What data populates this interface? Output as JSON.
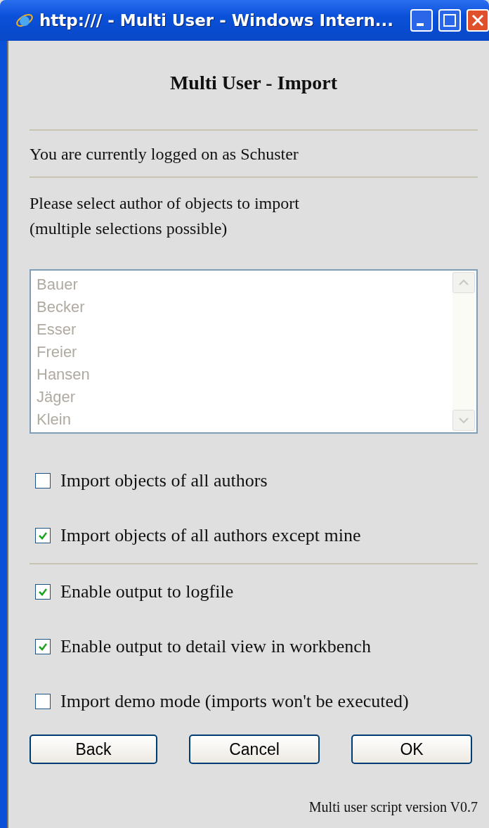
{
  "window": {
    "title": "http:/// - Multi User - Windows Intern..."
  },
  "heading": "Multi User - Import",
  "login_text": "You are currently logged on as Schuster",
  "instruction": [
    "Please select author of objects to import",
    "(multiple selections possible)"
  ],
  "author_list": {
    "disabled": true,
    "items": [
      "Bauer",
      "Becker",
      "Esser",
      "Freier",
      "Hansen",
      "Jäger",
      "Klein"
    ]
  },
  "option_groups": [
    [
      {
        "label": "Import objects of all authors",
        "checked": false
      },
      {
        "label": "Import objects of all authors except mine",
        "checked": true
      }
    ],
    [
      {
        "label": "Enable output to logfile",
        "checked": true
      },
      {
        "label": "Enable output to detail view in workbench",
        "checked": true
      },
      {
        "label": "Import demo mode (imports won't be executed)",
        "checked": false
      }
    ]
  ],
  "buttons": [
    "Back",
    "Cancel",
    "OK"
  ],
  "footer": "Multi user script version V0.7"
}
